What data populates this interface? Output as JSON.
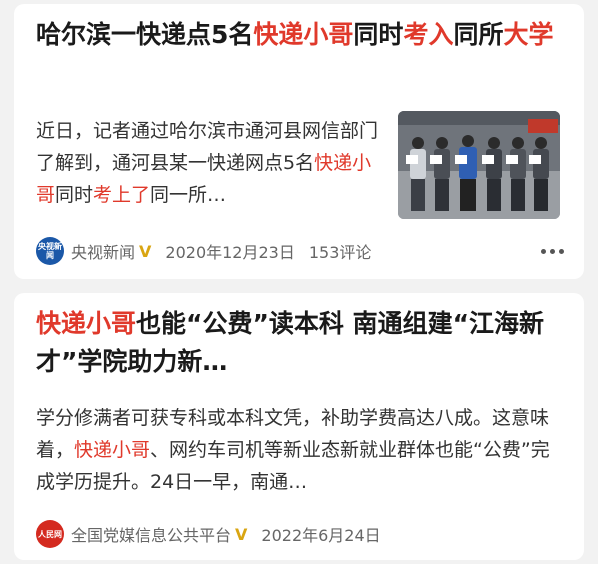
{
  "articles": [
    {
      "title_segments": [
        {
          "text": "哈尔滨一快递点5名",
          "highlight": false
        },
        {
          "text": "快递小哥",
          "highlight": true
        },
        {
          "text": "同时",
          "highlight": false
        },
        {
          "text": "考入",
          "highlight": true
        },
        {
          "text": "同所",
          "highlight": false
        },
        {
          "text": "大学",
          "highlight": true
        }
      ],
      "summary_segments": [
        {
          "text": "近日，记者通过哈尔滨市通河县网信部门了解到，通河县某一快递网点5名",
          "highlight": false
        },
        {
          "text": "快递小哥",
          "highlight": true
        },
        {
          "text": "同时",
          "highlight": false
        },
        {
          "text": "考上了",
          "highlight": true
        },
        {
          "text": "同一所…",
          "highlight": false
        }
      ],
      "source_logo_text": "央视新闻",
      "source": "央视新闻",
      "verified_mark": "V",
      "date": "2020年12月23日",
      "comments": "153评论",
      "thumbnail": "group-photo-five-couriers-holding-certificates"
    },
    {
      "title_segments": [
        {
          "text": "快递小哥",
          "highlight": true
        },
        {
          "text": "也能“公费”读本科 南通组建“江海新才”学院助力新…",
          "highlight": false
        }
      ],
      "summary_segments": [
        {
          "text": "学分修满者可获专科或本科文凭，补助学费高达八成。这意味着，",
          "highlight": false
        },
        {
          "text": "快递小哥",
          "highlight": true
        },
        {
          "text": "、网约车司机等新业态新就业群体也能“公费”完成学历提升。24日一早，南通…",
          "highlight": false
        }
      ],
      "source_logo_text": "人民网",
      "source": "全国党媒信息公共平台",
      "verified_mark": "V",
      "date": "2022年6月24日"
    }
  ],
  "colors": {
    "highlight": "#e0392b",
    "verified": "#d9a512",
    "background": "#f2f2f2",
    "card": "#ffffff"
  },
  "icons": [
    "more-icon",
    "verified-icon"
  ]
}
